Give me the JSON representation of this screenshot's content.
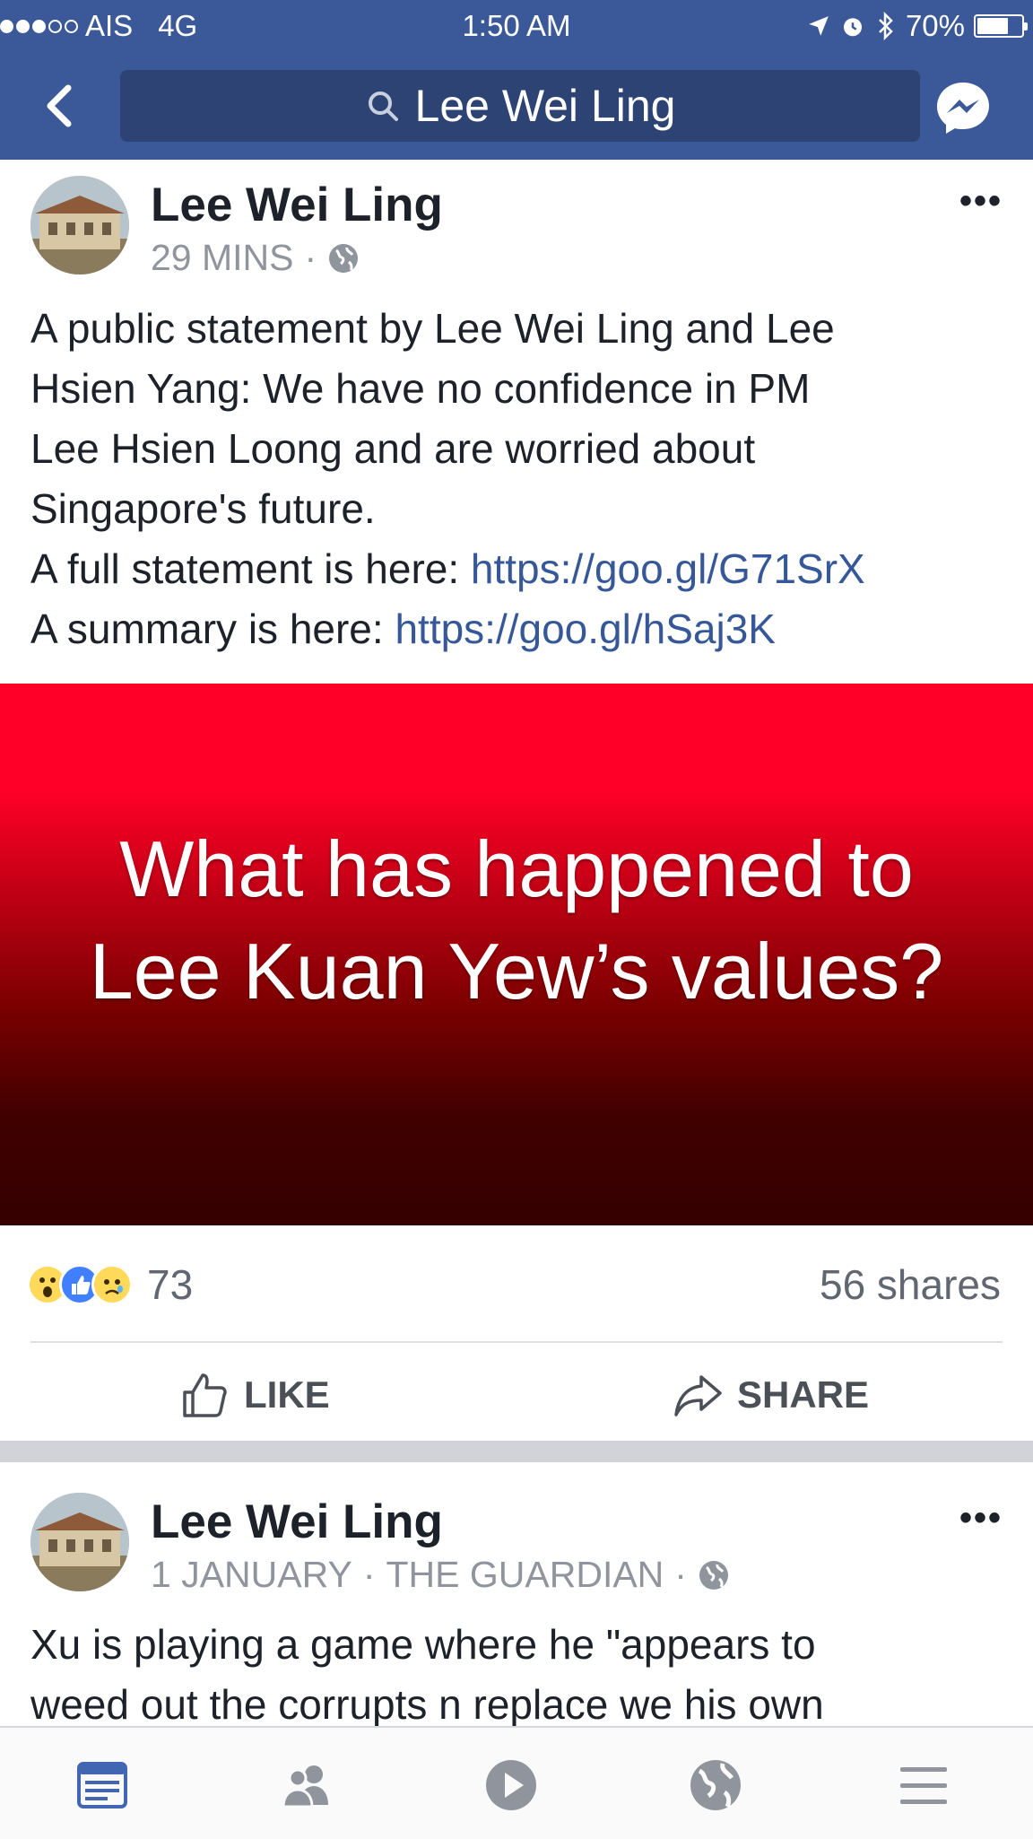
{
  "status_bar": {
    "carrier": "AIS",
    "network": "4G",
    "time": "1:50 AM",
    "battery": "70%",
    "battery_level": 0.7,
    "signal_bars_full": 3,
    "signal_bars_total": 5
  },
  "header": {
    "search_text": "Lee Wei Ling",
    "icons": [
      "back-arrow-icon",
      "search-icon",
      "messenger-icon"
    ]
  },
  "posts": [
    {
      "author": "Lee Wei Ling",
      "time": "29 MINS",
      "separator": "·",
      "more": "•••",
      "text_lines": [
        "A public statement by Lee Wei Ling and Lee",
        "Hsien Yang: We have no confidence in PM",
        "Lee Hsien Loong and are worried about",
        "Singapore's future."
      ],
      "full_label": "A full statement is here: ",
      "full_link": "https://goo.gl/G71SrX",
      "summary_label": "A summary is here: ",
      "summary_link": "https://goo.gl/hSaj3K",
      "image_text_line1": "What has happened to",
      "image_text_line2": "Lee Kuan Yew’s values?",
      "reaction_count": "73",
      "shares": "56 shares",
      "like_label": "LIKE",
      "share_label": "SHARE"
    },
    {
      "author": "Lee Wei Ling",
      "time": "1 JANUARY",
      "separator": "·",
      "source": "THE GUARDIAN",
      "more": "•••",
      "text_lines": [
        "Xu is playing a game where he \"appears to",
        "weed out the corrupts n replace we his own"
      ]
    }
  ],
  "colors": {
    "brand": "#3b5998",
    "link": "#365899",
    "banner_top": "#ff0028",
    "banner_bottom": "#350000",
    "active_tab": "#4267b2"
  },
  "tab_bar": {
    "tabs": [
      "news-feed-icon",
      "friends-icon",
      "video-icon",
      "globe-icon",
      "menu-icon"
    ],
    "active": "news-feed-icon"
  }
}
